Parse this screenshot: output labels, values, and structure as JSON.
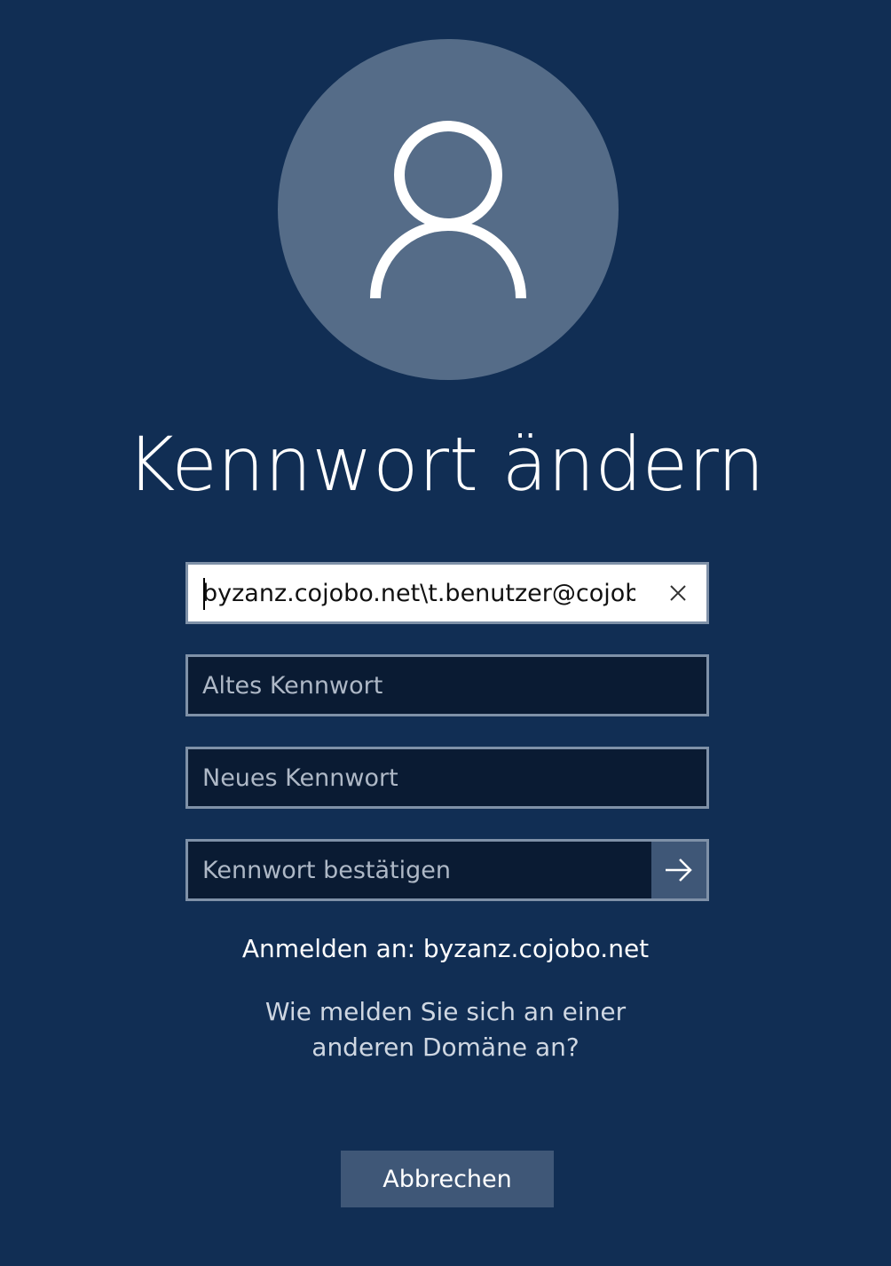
{
  "avatar": {
    "icon": "user-icon"
  },
  "title": "Kennwort ändern",
  "username_field": {
    "value": "byzanz.cojobo.net\\t.benutzer@cojob",
    "clear_icon": "close-icon"
  },
  "old_password": {
    "placeholder": "Altes Kennwort"
  },
  "new_password": {
    "placeholder": "Neues Kennwort"
  },
  "confirm_password": {
    "placeholder": "Kennwort bestätigen",
    "submit_icon": "arrow-right-icon"
  },
  "signin_to": "Anmelden an: byzanz.cojobo.net",
  "other_domain_link": "Wie melden Sie sich an einer anderen Domäne an?",
  "cancel_label": "Abbrechen",
  "colors": {
    "background": "#112e54",
    "avatar": "#556c88",
    "field_dark": "#0a1b33",
    "button": "#3f5777"
  }
}
